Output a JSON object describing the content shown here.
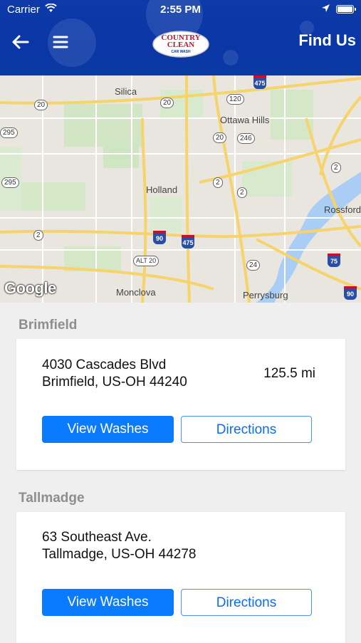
{
  "status": {
    "carrier": "Carrier",
    "time": "2:55 PM"
  },
  "header": {
    "title": "Find Us",
    "logo_line1": "COUNTRY",
    "logo_line2": "CLEAN",
    "logo_sub": "CAR WASH"
  },
  "map": {
    "places": [
      "Silica",
      "Ottawa Hills",
      "Holland",
      "Monclova",
      "Perrysburg",
      "Rossford"
    ],
    "routes": [
      "20",
      "120",
      "20",
      "246",
      "20",
      "2",
      "2",
      "295",
      "295",
      "2",
      "ALT 20",
      "24",
      "2"
    ],
    "interstates": [
      "475",
      "90",
      "475",
      "75",
      "90"
    ],
    "attribution": "Google"
  },
  "locations": [
    {
      "name": "Brimfield",
      "address_line1": "4030 Cascades Blvd",
      "address_line2": "Brimfield, US-OH  44240",
      "distance": "125.5 mi",
      "view_label": "View Washes",
      "directions_label": "Directions"
    },
    {
      "name": "Tallmadge",
      "address_line1": "63 Southeast Ave.",
      "address_line2": "Tallmadge, US-OH  44278",
      "view_label": "View Washes",
      "directions_label": "Directions"
    }
  ],
  "colors": {
    "header": "#0a36a6",
    "primary": "#0a7bff",
    "section": "#8e8e8e"
  }
}
